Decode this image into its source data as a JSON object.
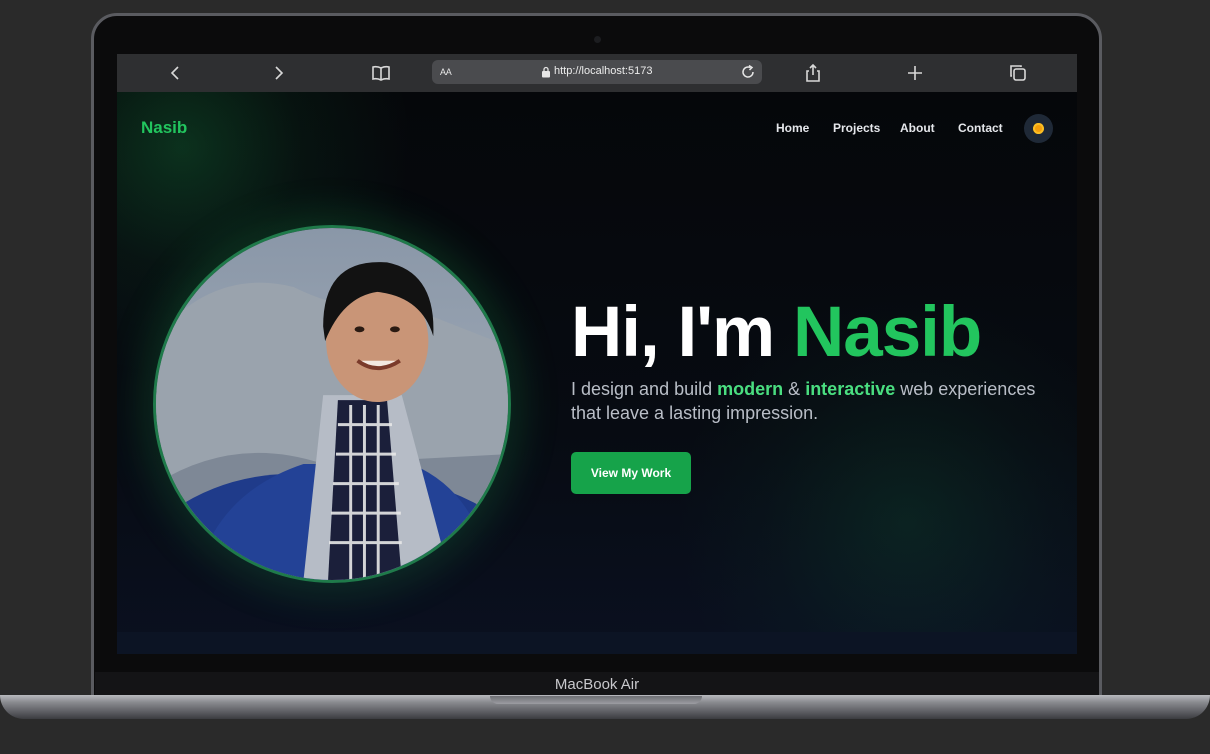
{
  "device": {
    "model_label": "MacBook Air"
  },
  "browser": {
    "url_prefix": "AA",
    "url": "http://localhost:5173"
  },
  "site": {
    "logo": "Nasib",
    "nav": [
      "Home",
      "Projects",
      "About",
      "Contact"
    ],
    "hero": {
      "greeting": "Hi, I'm",
      "name": "Nasib",
      "subtitle_parts": [
        "I design and build",
        "modern",
        "&",
        "interactive",
        "web experiences that leave a lasting impression."
      ],
      "cta_label": "View My Work"
    }
  },
  "colors": {
    "accent": "#22c55e",
    "button": "#16a34a",
    "background": "#05070a"
  },
  "icons": [
    "back-icon",
    "forward-icon",
    "bookmarks-icon",
    "lock-icon",
    "reload-icon",
    "share-icon",
    "new-tab-icon",
    "tabs-icon",
    "sun-icon"
  ]
}
